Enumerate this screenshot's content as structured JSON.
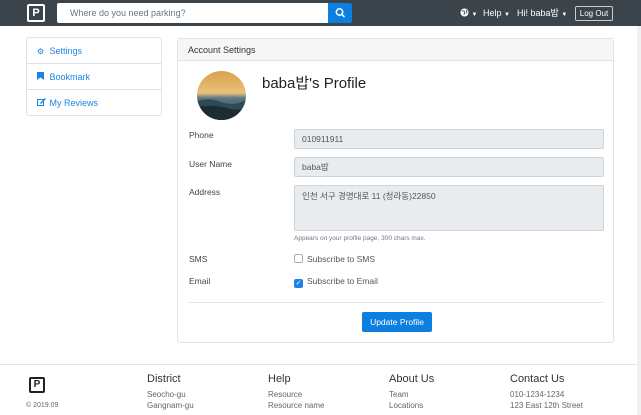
{
  "navbar": {
    "logo": "P",
    "search_placeholder": "Where do you need parking?",
    "help": "Help",
    "greeting": "Hi! baba밥",
    "logout": "Log Out"
  },
  "sidebar": {
    "items": [
      {
        "label": "Settings",
        "icon": "gear-icon"
      },
      {
        "label": "Bookmark",
        "icon": "bookmark-icon"
      },
      {
        "label": "My Reviews",
        "icon": "edit-icon"
      }
    ]
  },
  "card": {
    "header": "Account Settings",
    "profile_title": "baba밥's Profile",
    "labels": {
      "phone": "Phone",
      "username": "User Name",
      "address": "Address",
      "sms": "SMS",
      "email": "Email"
    },
    "values": {
      "phone": "010911911",
      "username": "baba밥",
      "address": "인천 서구 경명대로 11 (청라동)22850"
    },
    "address_hint": "Appears on your profile page, 300 chars max.",
    "sms_label": "Subscribe to SMS",
    "email_label": "Subscribe to Email",
    "sms_checked": false,
    "email_checked": true,
    "update_button": "Update Profile"
  },
  "footer": {
    "logo": "P",
    "copyright": "© 2019.09",
    "columns": [
      {
        "heading": "District",
        "items": [
          "Seocho-gu",
          "Gangnam-gu"
        ]
      },
      {
        "heading": "Help",
        "items": [
          "Resource",
          "Resource name"
        ]
      },
      {
        "heading": "About Us",
        "items": [
          "Team",
          "Locations"
        ]
      },
      {
        "heading": "Contact Us",
        "items": [
          "010-1234-1234",
          "123 East 12th Street"
        ]
      }
    ]
  },
  "colors": {
    "navbar": "#3b434b",
    "accent": "#0d7fe0",
    "link": "#1e82e6"
  }
}
